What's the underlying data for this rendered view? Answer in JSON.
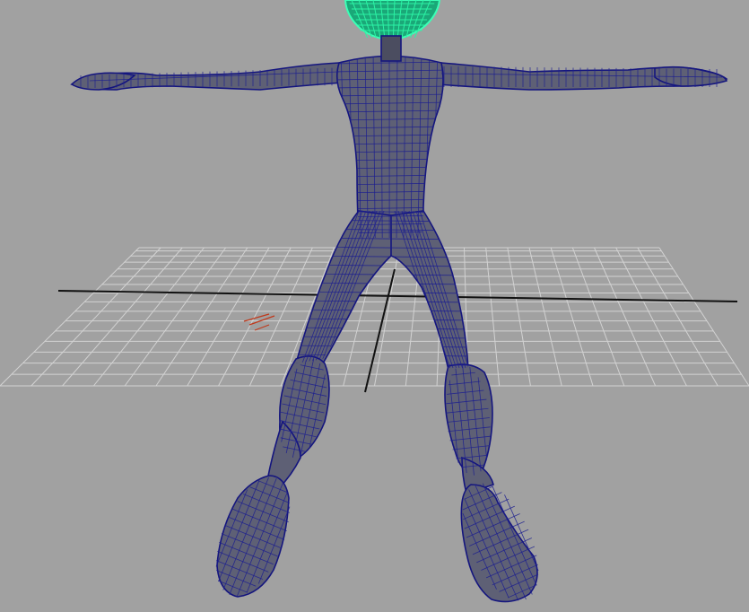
{
  "viewport": {
    "panel": "perspective",
    "background_color": "#a1a1a1",
    "grid_color": "#d2d2d2",
    "mesh_fill_color": "#5e6075",
    "wireframe_color": "#14157e",
    "selection_color": "#2bf3a5",
    "locator_color": "#c0391b"
  },
  "scene": {
    "objects": [
      {
        "name": "character-body",
        "state": "unselected"
      },
      {
        "name": "character-head",
        "state": "selected"
      }
    ],
    "ground_grid": true
  }
}
